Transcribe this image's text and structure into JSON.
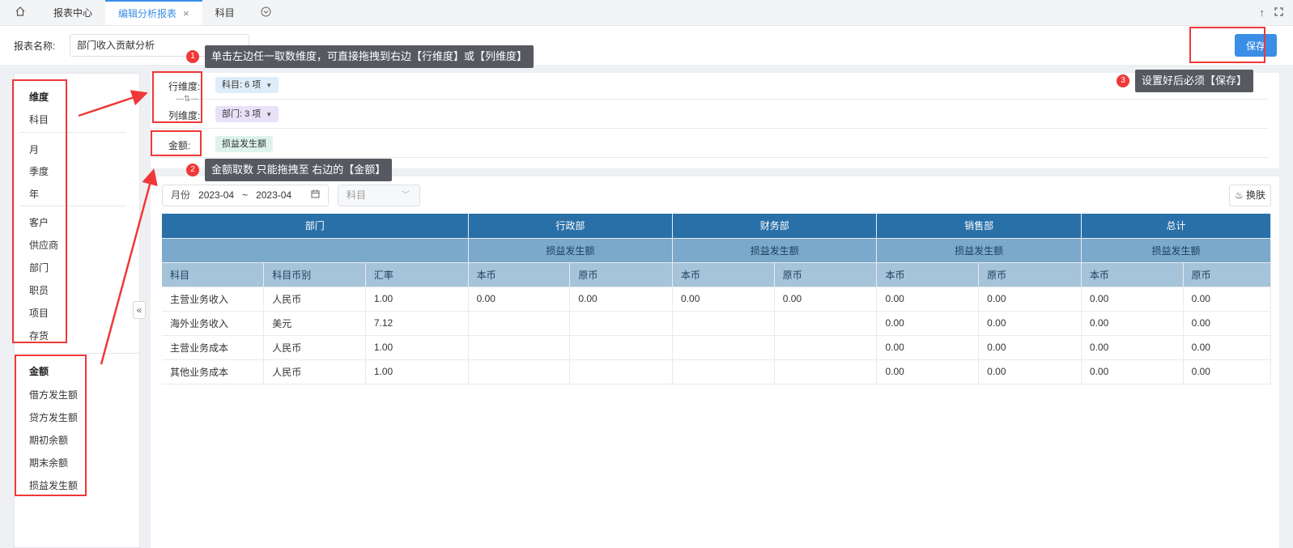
{
  "tabs": [
    {
      "label": "报表中心"
    },
    {
      "label": "编辑分析报表"
    },
    {
      "label": "科目"
    }
  ],
  "header": {
    "name_label": "报表名称:",
    "name_value": "部门收入贡献分析",
    "save_label": "保存"
  },
  "left_panel": {
    "dimension_heading": "维度",
    "dimension_groups": [
      [
        "科目"
      ],
      [
        "月",
        "季度",
        "年"
      ],
      [
        "客户",
        "供应商",
        "部门",
        "职员",
        "项目",
        "存货"
      ]
    ],
    "amount_heading": "金额",
    "amount_items": [
      "借方发生额",
      "贷方发生额",
      "期初余额",
      "期末余额",
      "损益发生额"
    ]
  },
  "dims": {
    "row_label": "行维度:",
    "row_chip": "科目: 6 项",
    "col_label": "列维度:",
    "col_chip": "部门: 3 项",
    "amount_label": "金额:",
    "amount_chip": "损益发生额"
  },
  "filters": {
    "month_label": "月份",
    "month_from": "2023-04",
    "month_sep": "~",
    "month_to": "2023-04",
    "subject_placeholder": "科目",
    "skin_label": "换肤"
  },
  "table": {
    "header_row1": [
      "部门",
      "行政部",
      "财务部",
      "销售部",
      "总计"
    ],
    "measure_label": "损益发生额",
    "left_cols": [
      "科目",
      "科目币别",
      "汇率"
    ],
    "money_cols": [
      "本币",
      "原币"
    ],
    "rows": [
      [
        "主营业务收入",
        "人民币",
        "1.00",
        "0.00",
        "0.00",
        "0.00",
        "0.00",
        "0.00",
        "0.00",
        "0.00",
        "0.00"
      ],
      [
        "海外业务收入",
        "美元",
        "7.12",
        "",
        "",
        "",
        "",
        "0.00",
        "0.00",
        "0.00",
        "0.00"
      ],
      [
        "主营业务成本",
        "人民币",
        "1.00",
        "",
        "",
        "",
        "",
        "0.00",
        "0.00",
        "0.00",
        "0.00"
      ],
      [
        "其他业务成本",
        "人民币",
        "1.00",
        "",
        "",
        "",
        "",
        "0.00",
        "0.00",
        "0.00",
        "0.00"
      ]
    ]
  },
  "annotations": [
    {
      "num": "1",
      "text": "单击左边任一取数维度，可直接拖拽到右边【行维度】或【列维度】"
    },
    {
      "num": "2",
      "text": "金额取数 只能拖拽至 右边的【金额】"
    },
    {
      "num": "3",
      "text": "设置好后必须【保存】"
    }
  ],
  "colors": {
    "accent": "#3a8ee6",
    "annotation_red": "#f03838",
    "header_dark": "#2a70a8"
  }
}
